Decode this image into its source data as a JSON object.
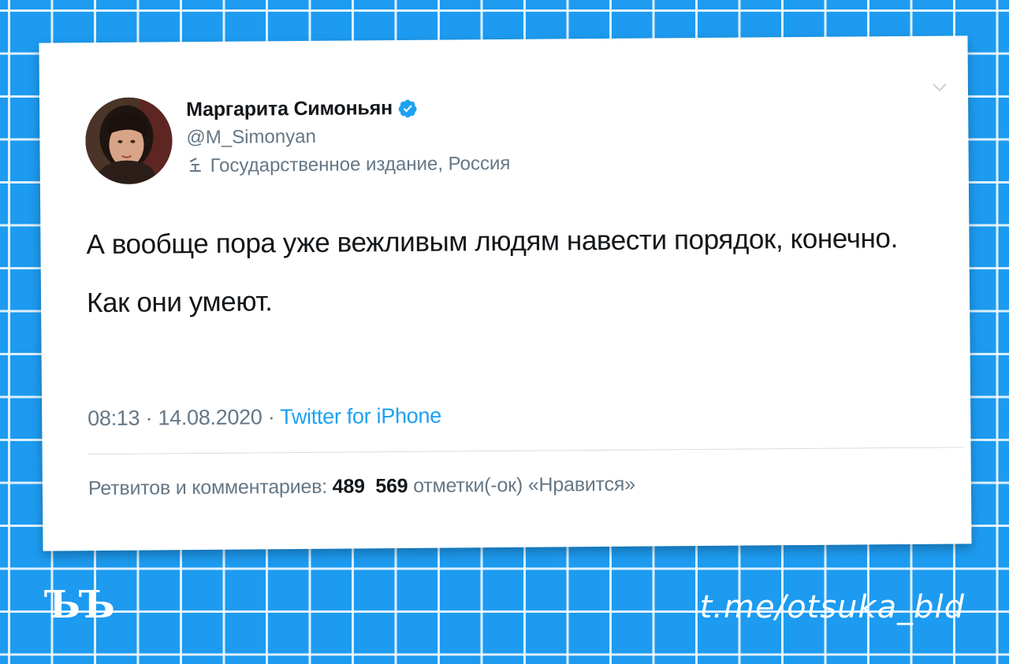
{
  "author": {
    "display_name": "Маргарита Симоньян",
    "handle": "@M_Simonyan",
    "state_label": "Государственное издание, Россия",
    "verified": true
  },
  "tweet": {
    "paragraphs": [
      "А вообще пора уже вежливым людям навести порядок, конечно.",
      "Как они умеют."
    ],
    "time": "08:13",
    "separator": "·",
    "date": "14.08.2020",
    "source": "Twitter for iPhone"
  },
  "stats": {
    "retweets_label": "Ретвитов и комментариев:",
    "retweets_count": "489",
    "likes_count": "569",
    "likes_label": "отметки(-ок) «Нравится»"
  },
  "overlay": {
    "logo_text": "ЪЪ",
    "channel_link": "t.me/otsuka_bld"
  },
  "icons": {
    "verified": "verified-badge-icon",
    "state_label": "lectern-icon",
    "more": "chevron-down-icon"
  },
  "colors": {
    "background": "#1d9bf0",
    "link": "#1da1f2",
    "text": "#14171a",
    "muted": "#657786"
  }
}
